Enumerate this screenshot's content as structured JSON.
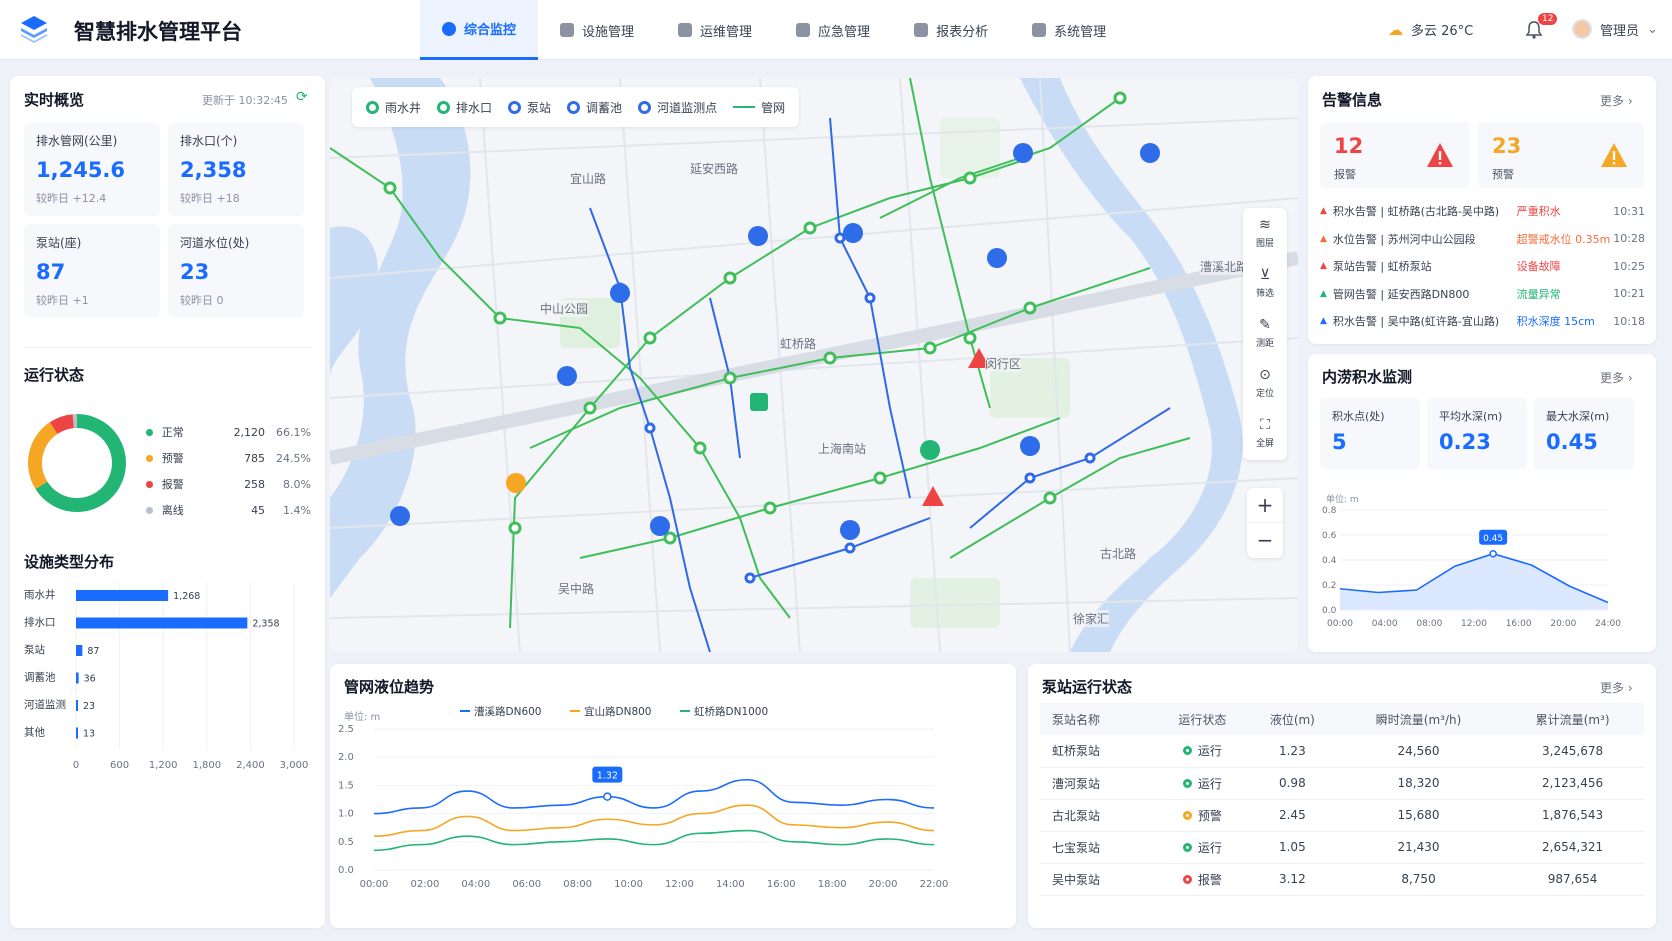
{
  "header": {
    "title": "智慧排水管理平台",
    "nav": [
      {
        "label": "综合监控",
        "active": true
      },
      {
        "label": "设施管理"
      },
      {
        "label": "运维管理"
      },
      {
        "label": "应急管理"
      },
      {
        "label": "报表分析"
      },
      {
        "label": "系统管理"
      }
    ],
    "weather": "多云  26°C",
    "bell_count": "12",
    "user": "管理员"
  },
  "overview": {
    "title": "实时概览",
    "updated": "更新于 10:32:45",
    "kpis": [
      {
        "label": "排水管网(公里)",
        "value": "1,245.6",
        "delta": "较昨日 +12.4"
      },
      {
        "label": "排水口(个)",
        "value": "2,358",
        "delta": "较昨日 +18"
      },
      {
        "label": "泵站(座)",
        "value": "87",
        "delta": "较昨日 +1"
      },
      {
        "label": "河道水位(处)",
        "value": "23",
        "delta": "较昨日  0"
      }
    ]
  },
  "status": {
    "title": "运行状态",
    "items": [
      {
        "name": "正常",
        "count": "2,120",
        "pct": "66.1%",
        "value": 66.1,
        "color": "#22b573"
      },
      {
        "name": "预警",
        "count": "785",
        "pct": "24.5%",
        "value": 24.5,
        "color": "#f5a623"
      },
      {
        "name": "报警",
        "count": "258",
        "pct": "8.0%",
        "value": 8.0,
        "color": "#ef4444"
      },
      {
        "name": "离线",
        "count": "45",
        "pct": "1.4%",
        "value": 1.4,
        "color": "#b8c0cc"
      }
    ]
  },
  "facility": {
    "title": "设施类型分布"
  },
  "map": {
    "legend": [
      "雨水井",
      "排水口",
      "泵站",
      "调蓄池",
      "河道监测点",
      "管网"
    ],
    "tools": [
      "图层",
      "筛选",
      "测距",
      "定位",
      "全屏"
    ],
    "zoom_in": "+",
    "zoom_out": "−",
    "labels": [
      "宜山路",
      "延安西路",
      "中山公园",
      "虹桥路",
      "吴中路",
      "古北路",
      "闵行区",
      "上海南站",
      "漕溪北路",
      "徐家汇"
    ]
  },
  "alarms": {
    "title": "告警信息",
    "more": "更多  ›",
    "alarm_count": "12",
    "alarm_label": "报警",
    "warn_count": "23",
    "warn_label": "预警",
    "items": [
      {
        "text": "积水告警 | 虹桥路(古北路-吴中路)",
        "tag": "严重积水",
        "time": "10:31",
        "color": "#ef4444"
      },
      {
        "text": "水位告警 | 苏州河中山公园段",
        "tag": "超警戒水位 0.35m",
        "time": "10:28",
        "color": "#f56c3a"
      },
      {
        "text": "泵站告警 | 虹桥泵站",
        "tag": "设备故障",
        "time": "10:25",
        "color": "#ef4444"
      },
      {
        "text": "管网告警 | 延安西路DN800",
        "tag": "流量异常",
        "time": "10:21",
        "color": "#22b573"
      },
      {
        "text": "积水告警 | 吴中路(虹许路-宜山路)",
        "tag": "积水深度 15cm",
        "time": "10:18",
        "color": "#1a6bff"
      }
    ]
  },
  "waterlog": {
    "title": "内涝积水监测",
    "more": "更多  ›",
    "cards": [
      {
        "label": "积水点(处)",
        "value": "5"
      },
      {
        "label": "平均水深(m)",
        "value": "0.23"
      },
      {
        "label": "最大水深(m)",
        "value": "0.45"
      }
    ],
    "unit": "单位:  m",
    "tip": "0.45"
  },
  "trend": {
    "title": "管网液位趋势",
    "unit": "单位:  m",
    "tip": "1.32"
  },
  "pumps": {
    "title": "泵站运行状态",
    "more": "更多  ›",
    "headers": [
      "泵站名称",
      "运行状态",
      "液位(m)",
      "瞬时流量(m³/h)",
      "累计流量(m³)"
    ],
    "rows": [
      {
        "name": "虹桥泵站",
        "status": "运行",
        "color": "#22b573",
        "level": "1.23",
        "flow": "24,560",
        "total": "3,245,678"
      },
      {
        "name": "漕河泵站",
        "status": "运行",
        "color": "#22b573",
        "level": "0.98",
        "flow": "18,320",
        "total": "2,123,456"
      },
      {
        "name": "古北泵站",
        "status": "预警",
        "color": "#f5a623",
        "level": "2.45",
        "flow": "15,680",
        "total": "1,876,543"
      },
      {
        "name": "七宝泵站",
        "status": "运行",
        "color": "#22b573",
        "level": "1.05",
        "flow": "21,430",
        "total": "2,654,321"
      },
      {
        "name": "吴中泵站",
        "status": "报警",
        "color": "#ef4444",
        "level": "3.12",
        "flow": "8,750",
        "total": "987,654"
      }
    ]
  },
  "chart_data": [
    {
      "type": "bar",
      "title": "设施类型分布",
      "categories": [
        "雨水井",
        "排水口",
        "泵站",
        "调蓄池",
        "河道监测",
        "其他"
      ],
      "values": [
        1268,
        2358,
        87,
        36,
        23,
        13
      ],
      "xlim": [
        0,
        3000
      ],
      "xticks": [
        "0",
        "600",
        "1,200",
        "1,800",
        "2,400",
        "3,000"
      ],
      "color": "#1a6bff"
    },
    {
      "type": "area",
      "title": "",
      "unit": "单位:  m",
      "x": [
        "00:00",
        "04:00",
        "08:00",
        "12:00",
        "16:00",
        "20:00",
        "24:00"
      ],
      "values": [
        0.17,
        0.14,
        0.16,
        0.35,
        0.45,
        0.36,
        0.19,
        0.06
      ],
      "ylim": [
        0,
        0.8
      ],
      "yticks": [
        "0.0",
        "0.2",
        "0.4",
        "0.6",
        "0.8"
      ],
      "color": "#1a6bff"
    },
    {
      "type": "line",
      "title": "管网液位趋势",
      "ylim": [
        0,
        2.5
      ],
      "yticks": [
        "0.0",
        "0.5",
        "1.0",
        "1.5",
        "2.0",
        "2.5"
      ],
      "x": [
        "00:00",
        "02:00",
        "04:00",
        "06:00",
        "08:00",
        "10:00",
        "12:00",
        "14:00",
        "16:00",
        "18:00",
        "20:00",
        "22:00"
      ],
      "series": [
        {
          "name": "漕溪路DN600",
          "color": "#1a6bff",
          "values": [
            1.0,
            1.1,
            1.4,
            1.1,
            1.15,
            1.3,
            1.1,
            1.4,
            1.6,
            1.2,
            1.15,
            1.25,
            1.1
          ]
        },
        {
          "name": "宜山路DN800",
          "color": "#f5a623",
          "values": [
            0.6,
            0.7,
            0.95,
            0.7,
            0.75,
            0.9,
            0.8,
            1.0,
            1.15,
            0.8,
            0.75,
            0.85,
            0.7
          ]
        },
        {
          "name": "虹桥路DN1000",
          "color": "#22b573",
          "values": [
            0.35,
            0.45,
            0.6,
            0.45,
            0.5,
            0.55,
            0.45,
            0.65,
            0.7,
            0.5,
            0.45,
            0.55,
            0.45
          ]
        }
      ]
    }
  ]
}
